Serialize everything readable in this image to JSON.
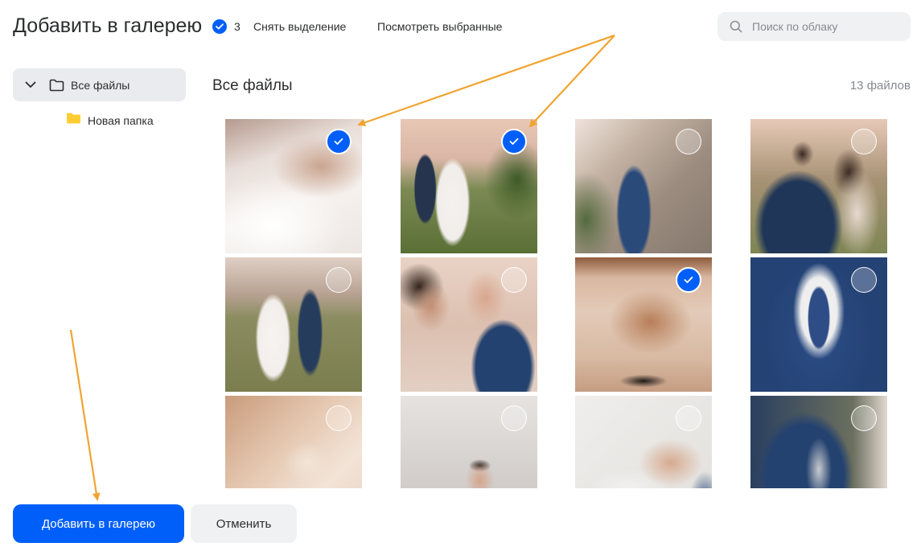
{
  "header": {
    "title": "Добавить в галерею",
    "selected_count": "3",
    "clear_selection_label": "Снять выделение",
    "view_selected_label": "Посмотреть выбранные",
    "search_placeholder": "Поиск по облаку"
  },
  "sidebar": {
    "root_label": "Все файлы",
    "child_label": "Новая папка",
    "folder_color": "#ffcc33"
  },
  "main": {
    "title": "Все файлы",
    "file_count": "13 файлов"
  },
  "photos": [
    {
      "name": "photo-bride-dress-closeup",
      "selected": true
    },
    {
      "name": "photo-couple-walking-back",
      "selected": true
    },
    {
      "name": "photo-groom-stone-wall",
      "selected": false
    },
    {
      "name": "photo-couple-back-view",
      "selected": false
    },
    {
      "name": "photo-couple-walking-castle",
      "selected": false
    },
    {
      "name": "photo-couple-face-to-face",
      "selected": false
    },
    {
      "name": "photo-table-shoes",
      "selected": true
    },
    {
      "name": "photo-groom-tie-closeup",
      "selected": false
    },
    {
      "name": "photo-bedroom-lamp",
      "selected": false
    },
    {
      "name": "photo-groom-chandelier",
      "selected": false
    },
    {
      "name": "photo-cufflinks-hands",
      "selected": false
    },
    {
      "name": "photo-groom-buttoning-jacket",
      "selected": false
    }
  ],
  "footer": {
    "add_label": "Добавить в галерею",
    "cancel_label": "Отменить"
  },
  "colors": {
    "accent": "#005ff9",
    "annotation_arrow": "#f0a431"
  }
}
